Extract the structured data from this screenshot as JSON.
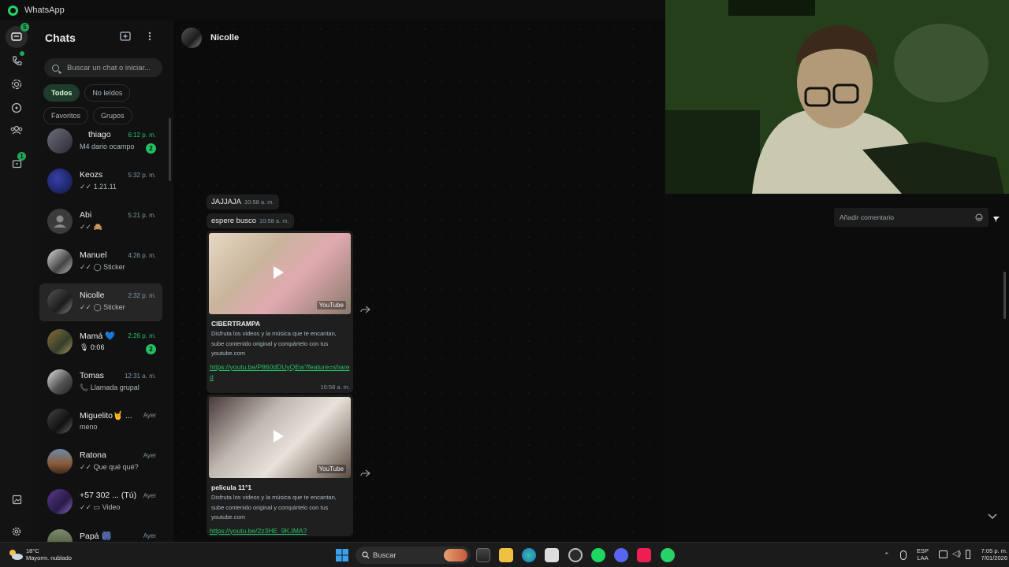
{
  "titlebar": {
    "app_name": "WhatsApp"
  },
  "rail": {
    "chats_badge": "5",
    "status_badge": "1"
  },
  "chatlist": {
    "title": "Chats",
    "search_placeholder": "Buscar un chat o iniciar...",
    "filters": [
      "Todos",
      "No leídos",
      "Favoritos",
      "Grupos"
    ],
    "items": [
      {
        "name": "thiago",
        "time": "6:12 p. m.",
        "preview": "M4 dario ocampo",
        "unread": "2"
      },
      {
        "name": "Keozs",
        "time": "5:32 p. m.",
        "preview": "✓✓ 1.21.11"
      },
      {
        "name": "Abi",
        "time": "5:21 p. m.",
        "preview": "✓✓ 🙈"
      },
      {
        "name": "Manuel",
        "time": "4:26 p. m.",
        "preview": "✓✓ ◯ Sticker"
      },
      {
        "name": "Nicolle",
        "time": "2:32 p. m.",
        "preview": "✓✓ ◯ Sticker"
      },
      {
        "name": "Mamá 💙",
        "time": "2:26 p. m.",
        "preview": "🎙 0:06",
        "unread": "2"
      },
      {
        "name": "Tomas",
        "time": "12:31 a. m.",
        "preview": "📞 Llamada grupal"
      },
      {
        "name": "Miguelito🤘 ...",
        "time": "Ayer",
        "preview": "meno"
      },
      {
        "name": "Ratona",
        "time": "Ayer",
        "preview": "✓✓ Que qué qué?"
      },
      {
        "name": "+57 302 ... (Tú)",
        "time": "Ayer",
        "preview": "✓✓ ▭ Video"
      },
      {
        "name": "Papá 🎆",
        "time": "Ayer",
        "preview": ""
      }
    ]
  },
  "conversation": {
    "contact_name": "Nicolle",
    "messages": [
      {
        "text": "JAJJAJA",
        "time": "10:58 a. m."
      },
      {
        "text": "espere busco",
        "time": "10:58 a. m."
      }
    ],
    "cards": [
      {
        "title": "CIBERTRAMPA",
        "desc": "Disfruta los videos y la música que te encantan, sube contenido original y compártelo con tus youtube.com",
        "link": "https://youtu.be/P860dDUyQEw?feature=shared",
        "time": "10:58 a. m.",
        "brand": "YouTube"
      },
      {
        "title": "pelicula 11°1",
        "desc": "Disfruta los videos y la música que te encantan, sube contenido original y compártelo con tus youtube.com",
        "link": "https://youtu.be/2z3HE_9K.IMA?",
        "time": "",
        "brand": "YouTube"
      }
    ]
  },
  "stream": {
    "comment_placeholder": "Añadir comentario"
  },
  "taskbar": {
    "weather_temp": "18°C",
    "weather_desc": "Mayorm. nublado",
    "search_label": "Buscar",
    "lang_top": "ESP",
    "lang_bottom": "LAA",
    "clock_time": "7:05 p. m.",
    "clock_date": "7/01/2026"
  },
  "colors": {
    "accent": "#21c063",
    "panel": "#111111",
    "selected": "#262626"
  }
}
